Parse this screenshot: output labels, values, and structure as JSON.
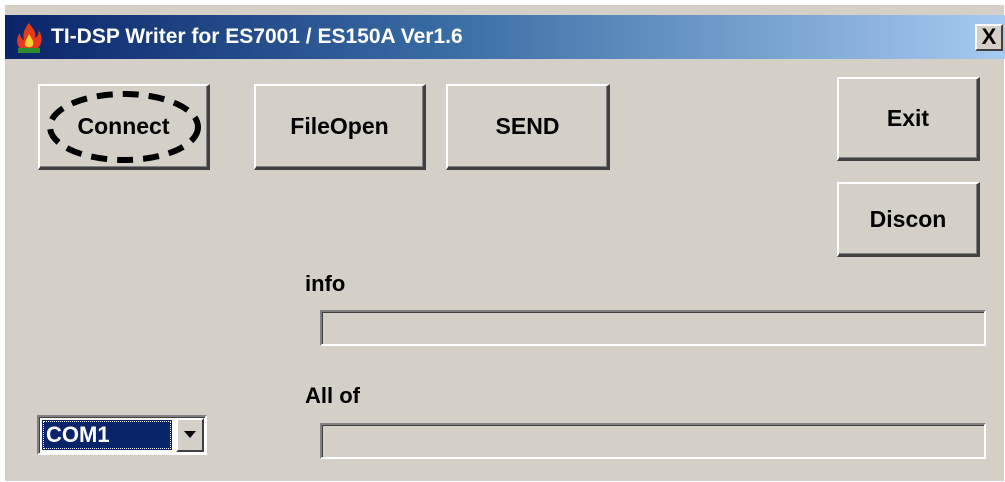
{
  "window": {
    "title": "TI-DSP Writer for ES7001 / ES150A Ver1.6",
    "close_label": "X"
  },
  "buttons": {
    "connect": "Connect",
    "fileopen": "FileOpen",
    "send": "SEND",
    "exit": "Exit",
    "discon": "Discon"
  },
  "labels": {
    "info": "info",
    "allof": "All of"
  },
  "fields": {
    "info_value": "",
    "allof_value": ""
  },
  "port_select": {
    "selected": "COM1"
  },
  "icons": {
    "app": "app-flame-icon",
    "dropdown": "chevron-down-icon"
  },
  "colors": {
    "titlebar_start": "#0a246a",
    "titlebar_end": "#a6caf0",
    "face": "#d4d0c8",
    "selection": "#0a246a"
  }
}
